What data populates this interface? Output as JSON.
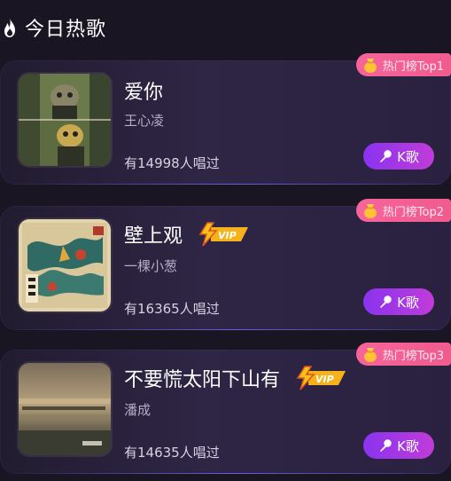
{
  "header": {
    "title": "今日热歌",
    "icon": "fire-icon"
  },
  "colors": {
    "background": "#191523",
    "rank_tag": "#f6649a",
    "k_button_start": "#8a33f0",
    "k_button_end": "#c03cd8",
    "vip_gold": "#f6b21a"
  },
  "songs": [
    {
      "title": "爱你",
      "artist": "王心凌",
      "count_text": "有14998人唱过",
      "rank_label": "热门榜Top1",
      "vip": false,
      "button_label": "K歌",
      "cover_icon": "cartoon-character-cover"
    },
    {
      "title": "壁上观",
      "artist": "一棵小葱",
      "count_text": "有16365人唱过",
      "rank_label": "热门榜Top2",
      "vip": true,
      "vip_label": "VIP",
      "button_label": "K歌",
      "cover_icon": "painting-cover"
    },
    {
      "title": "不要慌太阳下山有",
      "artist": "潘成",
      "count_text": "有14635人唱过",
      "rank_label": "热门榜Top3",
      "vip": true,
      "vip_label": "VIP",
      "button_label": "K歌",
      "cover_icon": "sunset-landscape-cover"
    }
  ]
}
